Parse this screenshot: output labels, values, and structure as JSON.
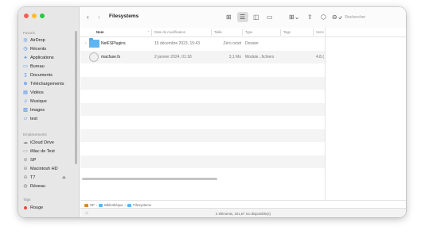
{
  "window": {
    "title": "Filesystems"
  },
  "sidebar": {
    "sections": [
      {
        "title": "Favoris",
        "items": [
          {
            "label": "AirDrop",
            "icon": "airdrop-icon",
            "glyph": "◎"
          },
          {
            "label": "Récents",
            "icon": "clock-icon",
            "glyph": "◷"
          },
          {
            "label": "Applications",
            "icon": "applications-icon",
            "glyph": "⚹"
          },
          {
            "label": "Bureau",
            "icon": "desktop-icon",
            "glyph": "▭"
          },
          {
            "label": "Documents",
            "icon": "document-icon",
            "glyph": "▯"
          },
          {
            "label": "Téléchargements",
            "icon": "download-icon",
            "glyph": "⊕"
          },
          {
            "label": "Vidéos",
            "icon": "film-icon",
            "glyph": "▤"
          },
          {
            "label": "Musique",
            "icon": "music-icon",
            "glyph": "♫"
          },
          {
            "label": "Images",
            "icon": "photo-icon",
            "glyph": "▨"
          },
          {
            "label": "test",
            "icon": "folder-icon",
            "glyph": "▱"
          }
        ]
      },
      {
        "title": "Emplacements",
        "items": [
          {
            "label": "iCloud Drive",
            "icon": "cloud-icon",
            "glyph": "☁"
          },
          {
            "label": "iMac de Test",
            "icon": "computer-icon",
            "glyph": "▭"
          },
          {
            "label": "SP",
            "icon": "disk-icon",
            "glyph": "⊖"
          },
          {
            "label": "Macintosh HD",
            "icon": "disk-icon",
            "glyph": "⊖"
          },
          {
            "label": "T7",
            "icon": "disk-icon",
            "glyph": "⊖",
            "eject": "⏏"
          },
          {
            "label": "Réseau",
            "icon": "network-icon",
            "glyph": "◍"
          }
        ]
      },
      {
        "title": "Tags",
        "items": [
          {
            "label": "Rouge",
            "icon": "red-tag-icon",
            "color": "#f2463d"
          }
        ]
      }
    ]
  },
  "toolbar": {
    "back": "‹",
    "forward": "›",
    "view_icons": "⊞",
    "view_list": "☰",
    "view_columns": "◫",
    "view_gallery": "▭",
    "group": "⊞⌄",
    "share": "⇪",
    "tag": "⬡",
    "action": "⊖⌄",
    "search_placeholder": "Rechercher",
    "search_glyph": "⌕"
  },
  "columns": {
    "name": "Nom",
    "sort_indicator": "⌃",
    "date": "Date de modification",
    "size": "Taille",
    "kind": "Type",
    "tags": "Tags",
    "version": "Versi"
  },
  "files": [
    {
      "name": "NetFSPlugins",
      "date": "15 décembre 2023, 15:43",
      "size": "Zéro octet",
      "kind": "Dossier",
      "tags": "",
      "version": "",
      "type": "folder",
      "disclosure": "›"
    },
    {
      "name": "macfuse.fs",
      "date": "2 janvier 2024, 01:18",
      "size": "3,1 Mo",
      "kind": "Module...fichiers",
      "tags": "",
      "version": "4.8.(",
      "type": "bundle",
      "disclosure": ""
    }
  ],
  "pathbar": [
    "SP",
    "Bibliothèque",
    "Filesystems"
  ],
  "pathbar_sep": "›",
  "status": {
    "text": "2 éléments, 101,67 Go disponible(s)",
    "close": "⤬"
  },
  "colors": {
    "accent": "#2d7ff2",
    "folder": "#5fb5ef",
    "tag_red": "#f2463d"
  }
}
